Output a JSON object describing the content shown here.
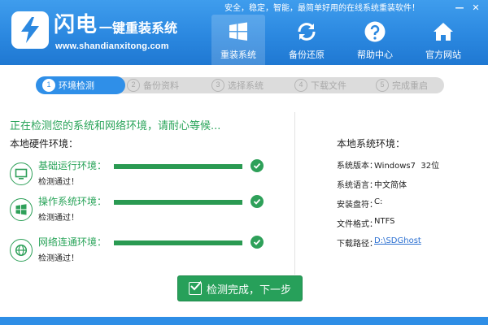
{
  "app": {
    "brand_main": "闪电",
    "brand_sub": "一键重装系统",
    "url": "www.shandianxitong.com",
    "slogan": "安全，稳定，智能，最简单好用的在线系统重装软件！"
  },
  "window_controls": [
    {
      "icon": "minimize-icon",
      "symbol": "—"
    },
    {
      "icon": "close-icon",
      "symbol": "✕"
    }
  ],
  "nav": [
    {
      "label": "重装系统",
      "icon": "windows-icon",
      "active": true
    },
    {
      "label": "备份还原",
      "icon": "refresh-icon",
      "active": false
    },
    {
      "label": "帮助中心",
      "icon": "help-icon",
      "active": false
    },
    {
      "label": "官方网站",
      "icon": "home-icon",
      "active": false
    }
  ],
  "steps": [
    {
      "num": "1",
      "label": "环境检测",
      "active": true
    },
    {
      "num": "2",
      "label": "备份资料",
      "active": false
    },
    {
      "num": "3",
      "label": "选择系统",
      "active": false
    },
    {
      "num": "4",
      "label": "下载文件",
      "active": false
    },
    {
      "num": "5",
      "label": "完成重启",
      "active": false
    }
  ],
  "checking_title": "正在检测您的系统和网络环境，请耐心等候...",
  "hardware_title": "本地硬件环境：",
  "environments": [
    {
      "name": "基础运行环境：",
      "status": "检测通过！",
      "icon": "monitor-icon",
      "progress": 1.0
    },
    {
      "name": "操作系统环境：",
      "status": "检测通过！",
      "icon": "windows-icon",
      "progress": 1.0
    },
    {
      "name": "网络连通环境：",
      "status": "检测通过！",
      "icon": "globe-icon",
      "progress": 1.0
    }
  ],
  "system_title": "本地系统环境：",
  "system_info": [
    {
      "label": "系统版本：",
      "value": "Windows7  32位",
      "link": false
    },
    {
      "label": "系统语言：",
      "value": "中文简体",
      "link": false
    },
    {
      "label": "安装盘符：",
      "value": "C:",
      "link": false
    },
    {
      "label": "文件格式：",
      "value": "NTFS",
      "link": false
    },
    {
      "label": "下载路径：",
      "value": "D:\\SDGhost",
      "link": true
    }
  ],
  "next_button": "检测完成，下一步",
  "colors": {
    "header_blue": "#2b88e0",
    "accent_green": "#2aa45a",
    "step_gray": "#dcdcdc"
  }
}
